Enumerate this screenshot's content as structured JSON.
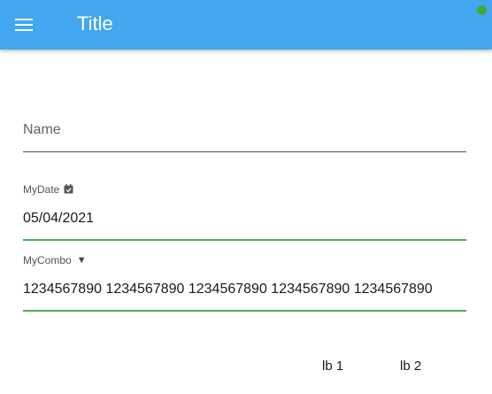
{
  "appbar": {
    "title": "Title",
    "menu_icon": "menu-icon",
    "status_color": "#3fa83a",
    "background": "#42a7f0"
  },
  "form": {
    "name": {
      "placeholder": "Name",
      "value": ""
    },
    "date": {
      "label": "MyDate",
      "icon": "calendar-check-icon",
      "value": "05/04/2021"
    },
    "combo": {
      "label": "MyCombo",
      "icon": "dropdown-caret-icon",
      "value": "1234567890 1234567890 1234567890 1234567890 1234567890"
    }
  },
  "footer": {
    "label1": "lb 1",
    "label2": "lb 2"
  },
  "colors": {
    "accent_green": "#4caf50"
  }
}
